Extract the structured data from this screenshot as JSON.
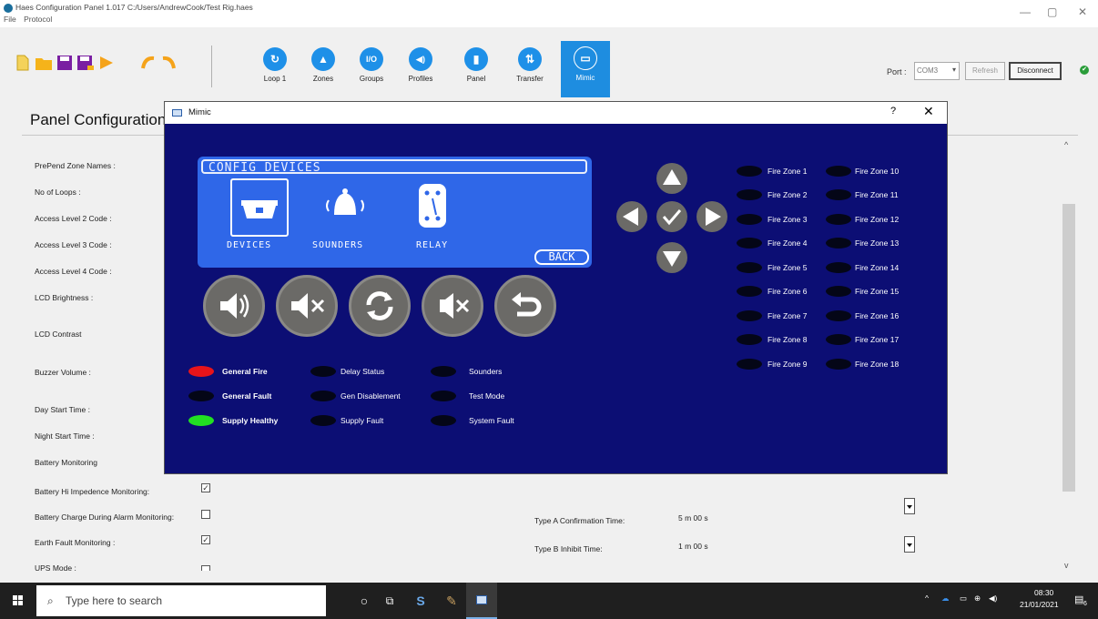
{
  "window": {
    "title": "Haes Configuration Panel 1.017   C:/Users/AndrewCook/Test Rig.haes",
    "menu": [
      "File",
      "Protocol"
    ],
    "controls": {
      "minimize": "—",
      "maximize": "▢",
      "close": "✕"
    }
  },
  "toolbar": {
    "nav": [
      {
        "label": "Loop 1",
        "icon": "loop-icon",
        "glyph": "↻"
      },
      {
        "label": "Zones",
        "icon": "zones-icon",
        "glyph": "▲"
      },
      {
        "label": "Groups",
        "icon": "groups-icon",
        "glyph": "I/O"
      },
      {
        "label": "Profiles",
        "icon": "profiles-icon",
        "glyph": "◀)"
      },
      {
        "label": "Panel",
        "icon": "panel-icon",
        "glyph": "▮"
      },
      {
        "label": "Transfer",
        "icon": "transfer-icon",
        "glyph": "⇅"
      },
      {
        "label": "Mimic",
        "icon": "mimic-icon",
        "glyph": "▭"
      }
    ],
    "active_tab": "Mimic",
    "port_label": "Port :",
    "port_value": "COM3",
    "refresh_label": "Refresh",
    "disconnect_label": "Disconnect",
    "accent": "#1e90e8"
  },
  "panel": {
    "title": "Panel Configuration",
    "fields": [
      {
        "label": "PrePend Zone Names :"
      },
      {
        "label": "No of Loops :"
      },
      {
        "label": "Access Level 2 Code :"
      },
      {
        "label": "Access Level 3 Code :"
      },
      {
        "label": "Access Level 4 Code :"
      },
      {
        "label": "LCD Brightness :"
      },
      {
        "label": "LCD Contrast"
      },
      {
        "label": "Buzzer Volume :"
      },
      {
        "label": "Day Start Time :"
      },
      {
        "label": "Night Start Time :"
      },
      {
        "label": "Battery Monitoring"
      },
      {
        "label": "Battery Hi Impedence Monitoring:",
        "checked": true
      },
      {
        "label": "Battery Charge During Alarm Monitoring:",
        "checked": false
      },
      {
        "label": "Earth Fault Monitoring :",
        "checked": true
      },
      {
        "label": "UPS Mode :",
        "checked": false
      }
    ],
    "right_fields": [
      {
        "label": "Type A Confirmation Time:",
        "value": "5 m 00 s"
      },
      {
        "label": "Type B Inhibit Time:",
        "value": "1 m 00 s"
      }
    ]
  },
  "mimic": {
    "title": "Mimic",
    "help": "?",
    "close": "✕",
    "lcd": {
      "header": "CONFIG DEVICES",
      "items": [
        "DEVICES",
        "SOUNDERS",
        "RELAY"
      ],
      "selected": "DEVICES",
      "back": "BACK"
    },
    "controls": [
      "sound-alarm",
      "silence-alarm",
      "reset",
      "silence-buzzer",
      "back"
    ],
    "status": [
      {
        "label": "General Fire",
        "state": "red",
        "bold": true
      },
      {
        "label": "General Fault",
        "state": "off",
        "bold": true
      },
      {
        "label": "Supply Healthy",
        "state": "green",
        "bold": true
      },
      {
        "label": "Delay Status",
        "state": "off"
      },
      {
        "label": "Gen Disablement",
        "state": "off"
      },
      {
        "label": "Supply Fault",
        "state": "off"
      },
      {
        "label": "Sounders",
        "state": "off"
      },
      {
        "label": "Test Mode",
        "state": "off"
      },
      {
        "label": "System Fault",
        "state": "off"
      }
    ],
    "zones_col1": [
      "Fire Zone 1",
      "Fire Zone 2",
      "Fire Zone 3",
      "Fire Zone 4",
      "Fire Zone 5",
      "Fire Zone 6",
      "Fire Zone 7",
      "Fire Zone 8",
      "Fire Zone 9"
    ],
    "zones_col2": [
      "Fire Zone 10",
      "Fire Zone 11",
      "Fire Zone 12",
      "Fire Zone 13",
      "Fire Zone 14",
      "Fire Zone 15",
      "Fire Zone 16",
      "Fire Zone 17",
      "Fire Zone 18"
    ],
    "colors": {
      "background": "#0c0e74",
      "lcd": "#2f67e8",
      "fire": "#e8141a",
      "healthy": "#22e022"
    }
  },
  "taskbar": {
    "search_placeholder": "Type here to search",
    "time": "08:30",
    "date": "21/01/2021",
    "notifications": "6"
  }
}
